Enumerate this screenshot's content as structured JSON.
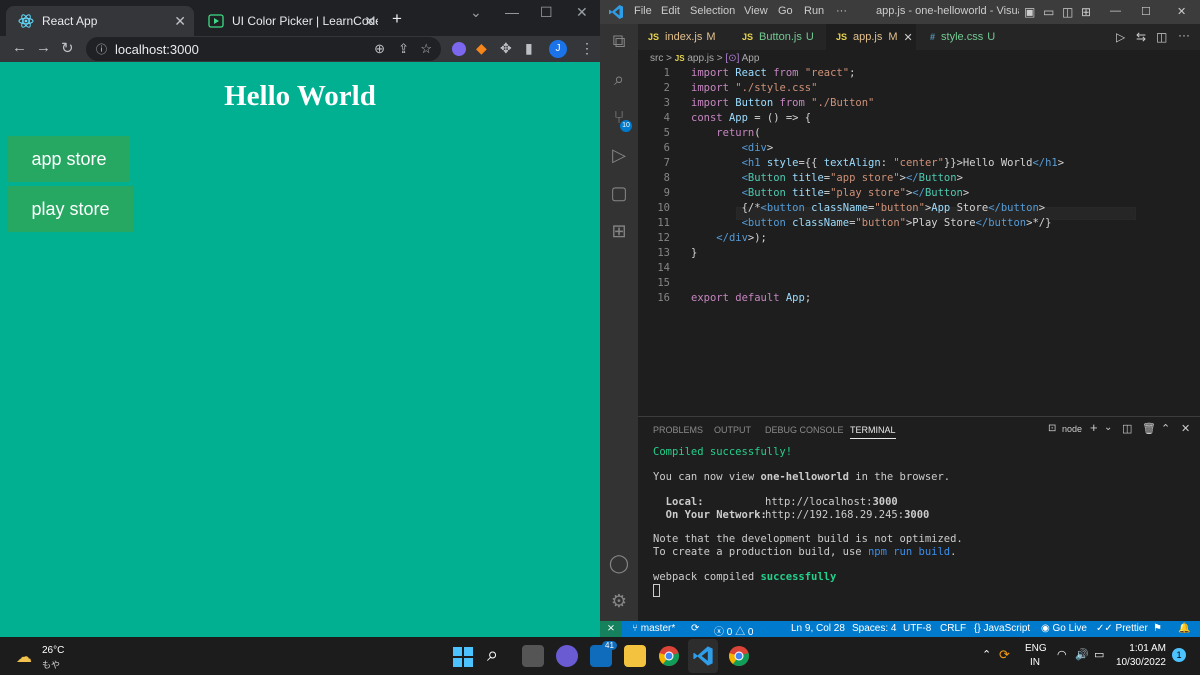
{
  "browser": {
    "tabs": [
      {
        "title": "React App"
      },
      {
        "title": "UI Color Picker | LearnCodeOnlin"
      }
    ],
    "url": "localhost:3000",
    "profile_initial": "J",
    "page": {
      "heading": "Hello World",
      "buttons": [
        "app store",
        "play store"
      ]
    },
    "colors": {
      "page_bg": "#00b091",
      "button_bg": "#27a862"
    }
  },
  "vscode": {
    "menu": [
      "File",
      "Edit",
      "Selection",
      "View",
      "Go",
      "Run",
      "···"
    ],
    "window_title": "app.js - one-helloworld - Visual S...",
    "tabs": [
      {
        "icon": "JS",
        "name": "index.js",
        "status": "M"
      },
      {
        "icon": "JS",
        "name": "Button.js",
        "status": "U"
      },
      {
        "icon": "JS",
        "name": "app.js",
        "status": "M"
      },
      {
        "icon": "#",
        "name": "style.css",
        "status": "U"
      }
    ],
    "breadcrumb": {
      "folder": "src",
      "file": "app.js",
      "symbol": "App"
    },
    "source_control_badge": "10",
    "code_lines": [
      "import React from \"react\";",
      "import \"./style.css\"",
      "import Button from \"./Button\"",
      "const App = () => {",
      "    return(",
      "        <div>",
      "        <h1 style={{ textAlign: \"center\"}}>Hello World</h1>",
      "        <Button title=\"app store\"></Button>",
      "        <Button title=\"play store\"></Button>",
      "        {/*<button className=\"button\">App Store</button>",
      "        <button className=\"button\">Play Store</button>*/}",
      "    </div>);",
      "}",
      "",
      "",
      "export default App;"
    ],
    "panel": {
      "tabs": [
        "PROBLEMS",
        "OUTPUT",
        "DEBUG CONSOLE",
        "TERMINAL"
      ],
      "terminal_name": "node",
      "terminal": {
        "compiled": "Compiled successfully!",
        "view_prefix": "You can now view ",
        "app_name": "one-helloworld",
        "view_suffix": " in the browser.",
        "local_label": "  Local:",
        "local_url": "http://localhost:",
        "local_port": "3000",
        "network_label": "  On Your Network:",
        "network_url": "http://192.168.29.245:",
        "network_port": "3000",
        "note1": "Note that the development build is not optimized.",
        "note2_prefix": "To create a production build, use ",
        "note2_cmd": "npm run build",
        "note2_suffix": ".",
        "webpack_prefix": "webpack compiled ",
        "webpack_status": "successfully"
      }
    },
    "status_bar": {
      "branch": "master*",
      "errors": "0",
      "warnings": "0",
      "position": "Ln 9, Col 28",
      "spaces": "Spaces: 4",
      "encoding": "UTF-8",
      "eol": "CRLF",
      "language": "JavaScript",
      "golive": "Go Live",
      "prettier": "Prettier"
    }
  },
  "taskbar": {
    "weather_temp": "26°C",
    "weather_desc": "もや",
    "mail_badge": "41",
    "lang": "ENG",
    "region": "IN",
    "time": "1:01 AM",
    "date": "10/30/2022",
    "notifications": "1"
  }
}
